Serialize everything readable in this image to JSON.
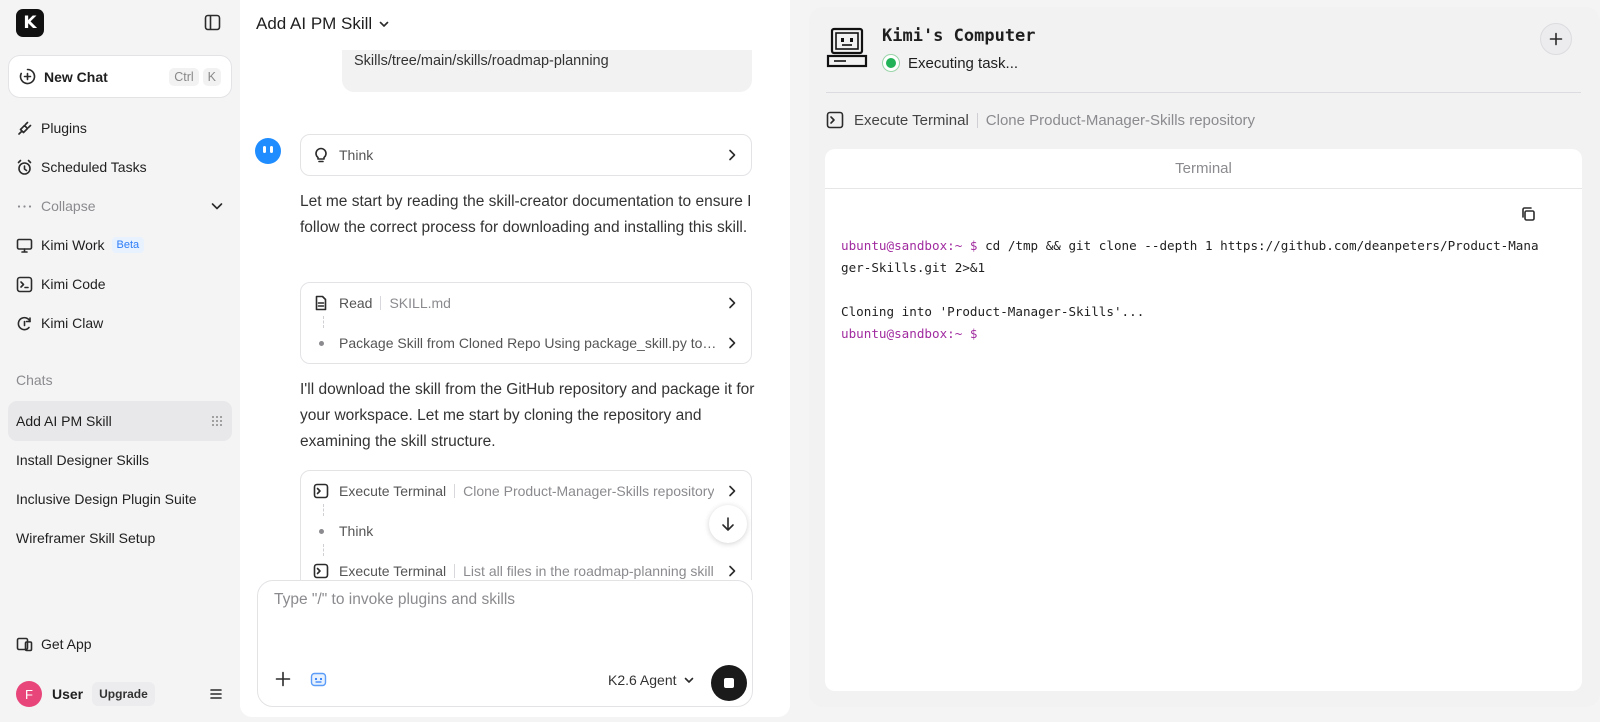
{
  "app": {
    "logo_letter": "K"
  },
  "sidebar": {
    "new_chat": {
      "label": "New Chat",
      "shortcut": [
        "Ctrl",
        "K"
      ]
    },
    "nav": [
      {
        "label": "Plugins",
        "icon": "plug-icon"
      },
      {
        "label": "Scheduled Tasks",
        "icon": "alarm-clock-icon"
      },
      {
        "label": "Collapse",
        "icon": "ellipsis-icon"
      },
      {
        "label": "Kimi Work",
        "icon": "monitor-icon",
        "badge": "Beta"
      },
      {
        "label": "Kimi Code",
        "icon": "terminal-icon"
      },
      {
        "label": "Kimi Claw",
        "icon": "claw-icon"
      }
    ],
    "chats_heading": "Chats",
    "chats": [
      "Add AI PM Skill",
      "Install Designer Skills",
      "Inclusive Design Plugin Suite",
      "Wireframer Skill Setup"
    ],
    "active_chat_index": 0,
    "get_app": "Get App",
    "user": {
      "avatar_letter": "F",
      "name": "User",
      "upgrade": "Upgrade",
      "avatar_color": "#e8457a"
    }
  },
  "chat": {
    "title": "Add AI PM Skill",
    "user_message_tail": "Skills/tree/main/skills/roadmap-planning",
    "think_label": "Think",
    "para1": "Let me start by reading the skill-creator documentation to ensure I follow the correct process for downloading and installing this skill.",
    "read_card": {
      "action": "Read",
      "file": "SKILL.md",
      "next": "Package Skill from Cloned Repo Using package_skill.py to O..."
    },
    "para2": "I'll download the skill from the GitHub repository and package it for your workspace. Let me start by cloning the repository and examining the skill structure.",
    "exec_card": {
      "action": "Execute Terminal",
      "desc": "Clone Product-Manager-Skills repository",
      "think": "Think",
      "action2": "Execute Terminal",
      "desc2": "List all files in the roadmap-planning skill"
    },
    "composer": {
      "placeholder": "Type \"/\" to invoke plugins and skills",
      "model": "K2.6 Agent"
    }
  },
  "computer": {
    "title": "Kimi's Computer",
    "status": "Executing task...",
    "status_color": "#22b257",
    "action": "Execute Terminal",
    "action_desc": "Clone Product-Manager-Skills repository",
    "terminal": {
      "header": "Terminal",
      "prompt1": "ubuntu@sandbox:~ $",
      "command1": " cd /tmp && git clone --depth 1 https://github.com/deanpeters/Product-Manager-Skills.git 2>&1",
      "output1": "Cloning into 'Product-Manager-Skills'...",
      "prompt2": "ubuntu@sandbox:~ $"
    }
  }
}
